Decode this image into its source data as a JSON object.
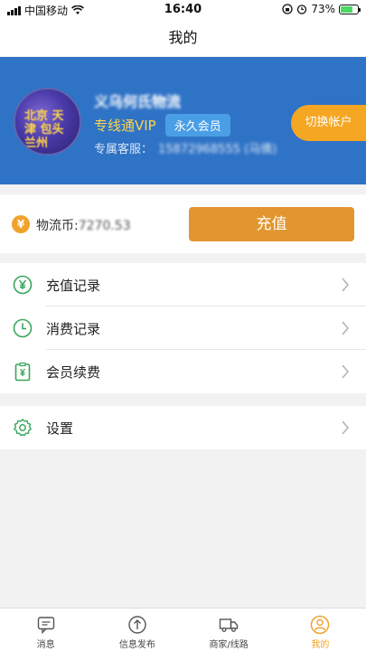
{
  "status_bar": {
    "carrier": "中国移动",
    "time": "16:40",
    "battery_percent": "73%",
    "battery_level": 0.73
  },
  "nav": {
    "title": "我的"
  },
  "profile": {
    "avatar_text": "北京 天津 包头 兰州",
    "company_name": "义乌何氏物流",
    "vip_label": "专线通VIP",
    "vip_badge": "永久会员",
    "service_label": "专属客服：",
    "service_phone": "15872968555 (马倩)",
    "switch_account": "切换帐户"
  },
  "balance": {
    "coin_symbol": "¥",
    "label": "物流币:",
    "value": "7270.53",
    "recharge_button": "充值"
  },
  "menu": {
    "records": [
      {
        "label": "充值记录",
        "icon": "yen-circle-icon"
      },
      {
        "label": "消费记录",
        "icon": "clock-icon"
      },
      {
        "label": "会员续费",
        "icon": "clipboard-yen-icon"
      }
    ],
    "settings": {
      "label": "设置",
      "icon": "gear-icon"
    }
  },
  "tabbar": {
    "tabs": [
      {
        "label": "消息",
        "icon": "message-icon"
      },
      {
        "label": "信息发布",
        "icon": "publish-icon"
      },
      {
        "label": "商家/线路",
        "icon": "truck-icon"
      },
      {
        "label": "我的",
        "icon": "user-icon"
      }
    ],
    "active_index": 3
  },
  "colors": {
    "profile_bg": "#2f73c6",
    "accent_orange": "#e1962f",
    "icon_green": "#3aa65c",
    "vip_gold": "#ffd34d"
  }
}
